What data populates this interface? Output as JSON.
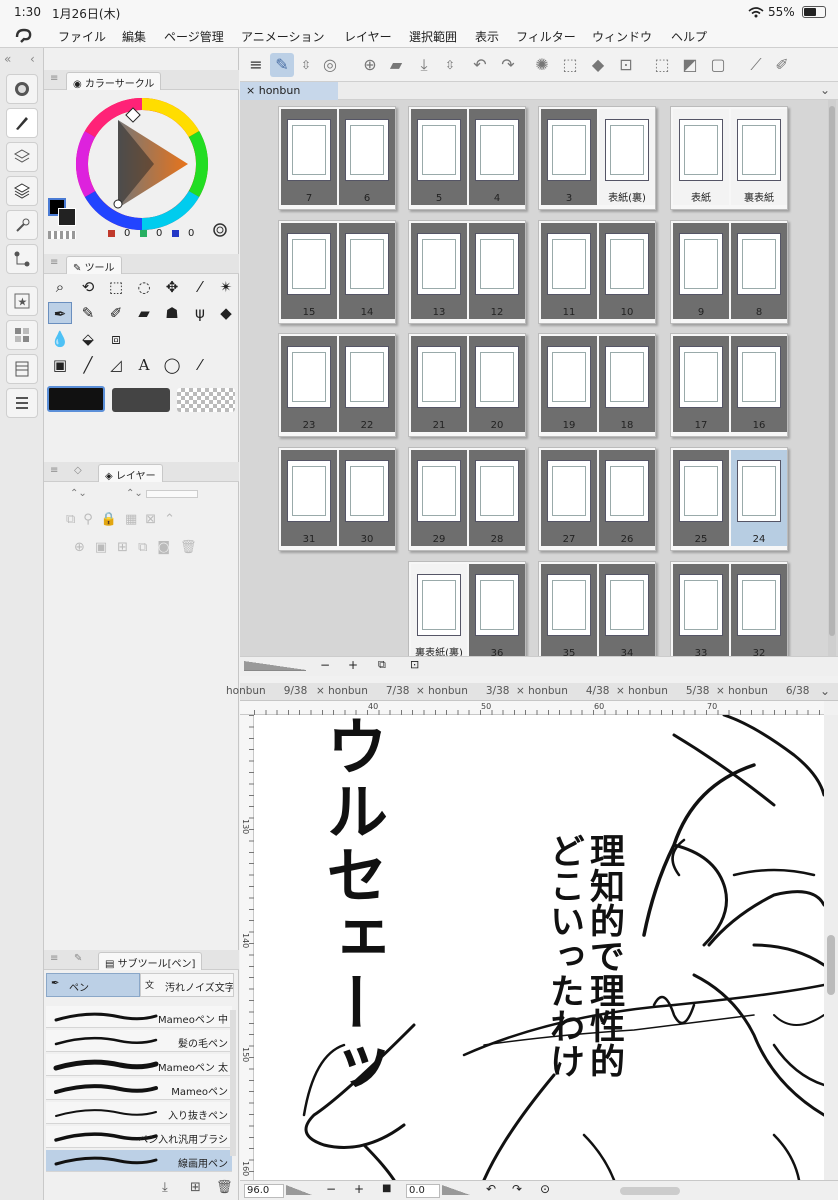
{
  "status_bar": {
    "time": "1:30",
    "date": "1月26日(木)",
    "battery": "55%"
  },
  "menu": [
    "ファイル",
    "編集",
    "ページ管理",
    "アニメーション",
    "レイヤー",
    "選択範囲",
    "表示",
    "フィルター",
    "ウィンドウ",
    "ヘルプ"
  ],
  "palettes": {
    "color": {
      "tab": "カラーサークル",
      "r": "0",
      "g": "0",
      "b": "0"
    },
    "tool": {
      "tab": "ツール"
    },
    "layer": {
      "tab": "レイヤー"
    },
    "subtool": {
      "tab": "サブツール[ペン]",
      "group_pen": "ペン",
      "group_noise": "汚れノイズ文字",
      "brushes": [
        "Mameoペン 中",
        "髪の毛ペン",
        "Mameoペン 太",
        "Mameoペン",
        "入り抜きペン",
        "ペン入れ汎用ブラシ",
        "線画用ペン"
      ]
    }
  },
  "page_manager": {
    "tab": "honbun",
    "rows": [
      [
        [
          "7",
          "6"
        ],
        [
          "5",
          "4"
        ],
        [
          "3",
          "表紙(裏)"
        ],
        [
          "表紙",
          "裏表紙"
        ]
      ],
      [
        [
          "15",
          "14"
        ],
        [
          "13",
          "12"
        ],
        [
          "11",
          "10"
        ],
        [
          "9",
          "8"
        ]
      ],
      [
        [
          "23",
          "22"
        ],
        [
          "21",
          "20"
        ],
        [
          "19",
          "18"
        ],
        [
          "17",
          "16"
        ]
      ],
      [
        [
          "31",
          "30"
        ],
        [
          "29",
          "28"
        ],
        [
          "27",
          "26"
        ],
        [
          "25",
          "24"
        ]
      ],
      [
        [
          "裏表紙(裏)",
          "36"
        ],
        [
          "35",
          "34"
        ],
        [
          "33",
          "32"
        ]
      ]
    ],
    "selected_page": "24"
  },
  "zoom": {
    "minus": "−",
    "plus": "+"
  },
  "doc_tabs": [
    {
      "name": "honbun",
      "page": "9/38"
    },
    {
      "name": "honbun",
      "page": "7/38"
    },
    {
      "name": "honbun",
      "page": "3/38"
    },
    {
      "name": "honbun",
      "page": "4/38"
    },
    {
      "name": "honbun",
      "page": "5/38"
    },
    {
      "name": "honbun",
      "page": "6/38"
    }
  ],
  "ruler": {
    "h": [
      "40",
      "50",
      "60",
      "70"
    ],
    "v": [
      "130",
      "140",
      "150",
      "160"
    ]
  },
  "canvas_text": {
    "sfx": "ウルセェーッ",
    "line1": "理知的で理性的",
    "line2": "どこいったわけ"
  },
  "bottom_bar": {
    "zoom_value": "96.0",
    "rotation_value": "0.0"
  }
}
